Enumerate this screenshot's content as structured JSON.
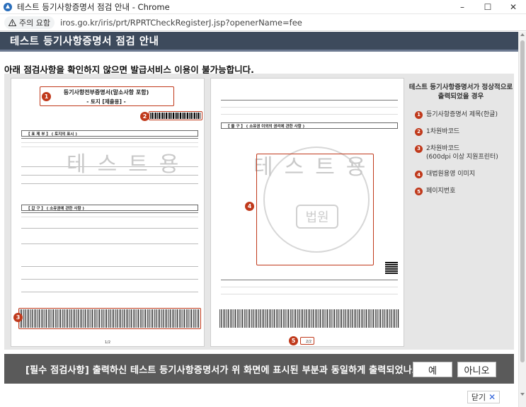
{
  "window": {
    "title": "테스트 등기사항증명서 점검 안내 - Chrome",
    "controls": {
      "minimize": "–",
      "maximize": "☐",
      "close": "✕"
    }
  },
  "addressbar": {
    "security_label": "주의 요함",
    "url": "iros.go.kr/iris/prt/RPRTCheckRegisterJ.jsp?openerName=fee"
  },
  "header": {
    "title": "테스트 등기사항증명서 점검 안내"
  },
  "notice": "아래 점검사항을 확인하지 않으면 발급서비스 이용이 불가능합니다.",
  "preview": {
    "doc1": {
      "title_line1": "등기사항전부증명서(말소사항 포함)",
      "title_line2": "- 토지 [제출용] -",
      "section1": "【 표 제 부 】 ( 토지의 표시 )",
      "section2": "【 갑   구 】 ( 소유권에 관한 사항 )",
      "watermark": "테스트용",
      "page": "1/2"
    },
    "doc2": {
      "section1": "【 을   구 】 ( 소유권 이외의 권리에 관한 사항 )",
      "watermark": "테스트용",
      "seal": "법원",
      "page": "2/2"
    },
    "markers": [
      "1",
      "2",
      "3",
      "4",
      "5"
    ]
  },
  "legend": {
    "heading": "테스트 등기사항증명서가 정상적으로 출력되었을 경우",
    "items": [
      {
        "num": "1",
        "text": "등기사항증명서 제목(한글)"
      },
      {
        "num": "2",
        "text": "1차원바코드"
      },
      {
        "num": "3",
        "text": "2차원바코드\n(600dpi 이상 지원프린터)"
      },
      {
        "num": "4",
        "text": "대법원용영 이미지"
      },
      {
        "num": "5",
        "text": "페이지번호"
      }
    ]
  },
  "confirm": {
    "question": "[필수 점검사항] 출력하신 테스트 등기사항증명서가 위 화면에 표시된 부분과 동일하게 출력되었나요?",
    "yes": "예",
    "no": "아니오"
  },
  "close_label": "닫기",
  "colors": {
    "header_bg": "#3d4a5c",
    "accent": "#c0391b",
    "confirm_bg": "#5a5a5a"
  }
}
